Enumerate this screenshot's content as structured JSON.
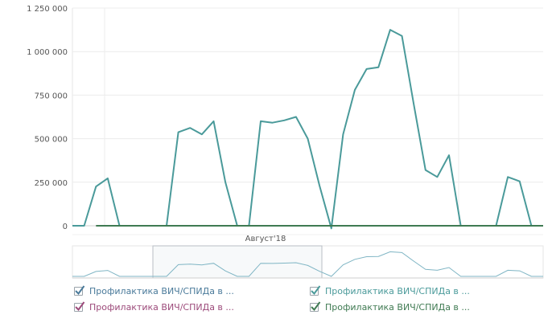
{
  "chart_data": {
    "type": "line",
    "title": "",
    "xlabel": "",
    "ylabel": "",
    "x_period_label": "Август'18",
    "ylim": [
      0,
      1250000
    ],
    "yticks": [
      0,
      250000,
      500000,
      750000,
      1000000,
      1250000
    ],
    "ytick_labels": [
      "0",
      "250 000",
      "500 000",
      "750 000",
      "1 000 000",
      "1 250 000"
    ],
    "x_points": 41,
    "series": [
      {
        "name": "Профилактика ВИЧ/СПИДа в ...",
        "color": "#4a9a9a",
        "checked": true,
        "start": 0,
        "values": [
          0,
          0,
          225000,
          272000,
          0,
          0,
          0,
          0,
          0,
          537000,
          562000,
          525000,
          600000,
          250000,
          0,
          0,
          600000,
          592000,
          605000,
          625000,
          500000,
          230000,
          -15000,
          525000,
          780000,
          900000,
          910000,
          1125000,
          1090000,
          700000,
          320000,
          280000,
          405000,
          0,
          0,
          0,
          0,
          280000,
          255000,
          0,
          0
        ]
      },
      {
        "name": "Профилактика ВИЧ/СПИДа в ...",
        "color": "#3f7a52",
        "checked": true,
        "start": 2,
        "values": [
          0,
          0,
          0,
          0,
          0,
          0,
          0,
          0,
          0,
          0,
          0,
          0,
          0,
          0,
          0,
          0,
          0,
          0,
          0,
          0,
          0,
          0,
          0,
          0,
          0,
          0,
          0,
          0,
          0,
          0,
          0,
          0,
          0,
          0,
          0,
          0,
          0,
          0,
          0
        ]
      },
      {
        "name": "Профилактика ВИЧ/СПИДа в ...",
        "color": "#9c4a7a",
        "checked": true
      }
    ],
    "legend_placement": "bottom",
    "grid": true
  },
  "legend": [
    {
      "label": "Профилактика ВИЧ/СПИДа в ...",
      "color": "#4a7a9a"
    },
    {
      "label": "Профилактика ВИЧ/СПИДа в ...",
      "color": "#4a9a9a"
    },
    {
      "label": "Профилактика ВИЧ/СПИДа в ...",
      "color": "#9c4a7a"
    },
    {
      "label": "Профилактика ВИЧ/СПИДа в ...",
      "color": "#3f7a52"
    }
  ]
}
